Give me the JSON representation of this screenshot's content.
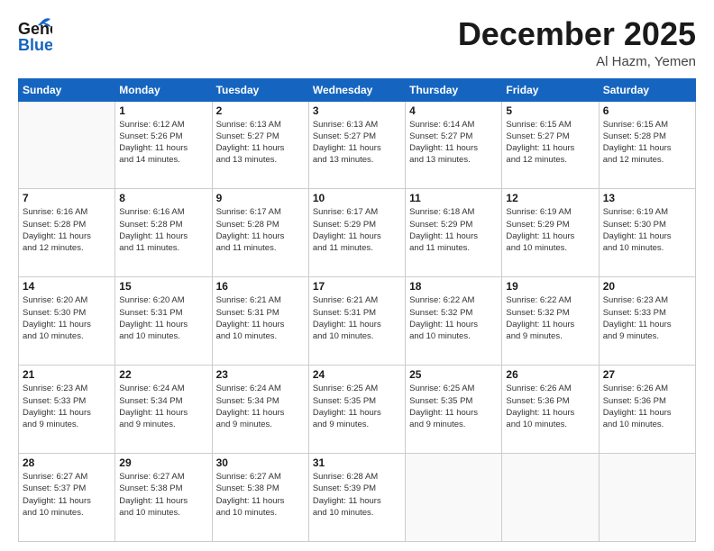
{
  "header": {
    "logo_line1": "General",
    "logo_line2": "Blue",
    "month": "December 2025",
    "location": "Al Hazm, Yemen"
  },
  "weekdays": [
    "Sunday",
    "Monday",
    "Tuesday",
    "Wednesday",
    "Thursday",
    "Friday",
    "Saturday"
  ],
  "weeks": [
    [
      {
        "day": "",
        "info": ""
      },
      {
        "day": "1",
        "info": "Sunrise: 6:12 AM\nSunset: 5:26 PM\nDaylight: 11 hours\nand 14 minutes."
      },
      {
        "day": "2",
        "info": "Sunrise: 6:13 AM\nSunset: 5:27 PM\nDaylight: 11 hours\nand 13 minutes."
      },
      {
        "day": "3",
        "info": "Sunrise: 6:13 AM\nSunset: 5:27 PM\nDaylight: 11 hours\nand 13 minutes."
      },
      {
        "day": "4",
        "info": "Sunrise: 6:14 AM\nSunset: 5:27 PM\nDaylight: 11 hours\nand 13 minutes."
      },
      {
        "day": "5",
        "info": "Sunrise: 6:15 AM\nSunset: 5:27 PM\nDaylight: 11 hours\nand 12 minutes."
      },
      {
        "day": "6",
        "info": "Sunrise: 6:15 AM\nSunset: 5:28 PM\nDaylight: 11 hours\nand 12 minutes."
      }
    ],
    [
      {
        "day": "7",
        "info": "Sunrise: 6:16 AM\nSunset: 5:28 PM\nDaylight: 11 hours\nand 12 minutes."
      },
      {
        "day": "8",
        "info": "Sunrise: 6:16 AM\nSunset: 5:28 PM\nDaylight: 11 hours\nand 11 minutes."
      },
      {
        "day": "9",
        "info": "Sunrise: 6:17 AM\nSunset: 5:28 PM\nDaylight: 11 hours\nand 11 minutes."
      },
      {
        "day": "10",
        "info": "Sunrise: 6:17 AM\nSunset: 5:29 PM\nDaylight: 11 hours\nand 11 minutes."
      },
      {
        "day": "11",
        "info": "Sunrise: 6:18 AM\nSunset: 5:29 PM\nDaylight: 11 hours\nand 11 minutes."
      },
      {
        "day": "12",
        "info": "Sunrise: 6:19 AM\nSunset: 5:29 PM\nDaylight: 11 hours\nand 10 minutes."
      },
      {
        "day": "13",
        "info": "Sunrise: 6:19 AM\nSunset: 5:30 PM\nDaylight: 11 hours\nand 10 minutes."
      }
    ],
    [
      {
        "day": "14",
        "info": "Sunrise: 6:20 AM\nSunset: 5:30 PM\nDaylight: 11 hours\nand 10 minutes."
      },
      {
        "day": "15",
        "info": "Sunrise: 6:20 AM\nSunset: 5:31 PM\nDaylight: 11 hours\nand 10 minutes."
      },
      {
        "day": "16",
        "info": "Sunrise: 6:21 AM\nSunset: 5:31 PM\nDaylight: 11 hours\nand 10 minutes."
      },
      {
        "day": "17",
        "info": "Sunrise: 6:21 AM\nSunset: 5:31 PM\nDaylight: 11 hours\nand 10 minutes."
      },
      {
        "day": "18",
        "info": "Sunrise: 6:22 AM\nSunset: 5:32 PM\nDaylight: 11 hours\nand 10 minutes."
      },
      {
        "day": "19",
        "info": "Sunrise: 6:22 AM\nSunset: 5:32 PM\nDaylight: 11 hours\nand 9 minutes."
      },
      {
        "day": "20",
        "info": "Sunrise: 6:23 AM\nSunset: 5:33 PM\nDaylight: 11 hours\nand 9 minutes."
      }
    ],
    [
      {
        "day": "21",
        "info": "Sunrise: 6:23 AM\nSunset: 5:33 PM\nDaylight: 11 hours\nand 9 minutes."
      },
      {
        "day": "22",
        "info": "Sunrise: 6:24 AM\nSunset: 5:34 PM\nDaylight: 11 hours\nand 9 minutes."
      },
      {
        "day": "23",
        "info": "Sunrise: 6:24 AM\nSunset: 5:34 PM\nDaylight: 11 hours\nand 9 minutes."
      },
      {
        "day": "24",
        "info": "Sunrise: 6:25 AM\nSunset: 5:35 PM\nDaylight: 11 hours\nand 9 minutes."
      },
      {
        "day": "25",
        "info": "Sunrise: 6:25 AM\nSunset: 5:35 PM\nDaylight: 11 hours\nand 9 minutes."
      },
      {
        "day": "26",
        "info": "Sunrise: 6:26 AM\nSunset: 5:36 PM\nDaylight: 11 hours\nand 10 minutes."
      },
      {
        "day": "27",
        "info": "Sunrise: 6:26 AM\nSunset: 5:36 PM\nDaylight: 11 hours\nand 10 minutes."
      }
    ],
    [
      {
        "day": "28",
        "info": "Sunrise: 6:27 AM\nSunset: 5:37 PM\nDaylight: 11 hours\nand 10 minutes."
      },
      {
        "day": "29",
        "info": "Sunrise: 6:27 AM\nSunset: 5:38 PM\nDaylight: 11 hours\nand 10 minutes."
      },
      {
        "day": "30",
        "info": "Sunrise: 6:27 AM\nSunset: 5:38 PM\nDaylight: 11 hours\nand 10 minutes."
      },
      {
        "day": "31",
        "info": "Sunrise: 6:28 AM\nSunset: 5:39 PM\nDaylight: 11 hours\nand 10 minutes."
      },
      {
        "day": "",
        "info": ""
      },
      {
        "day": "",
        "info": ""
      },
      {
        "day": "",
        "info": ""
      }
    ]
  ]
}
